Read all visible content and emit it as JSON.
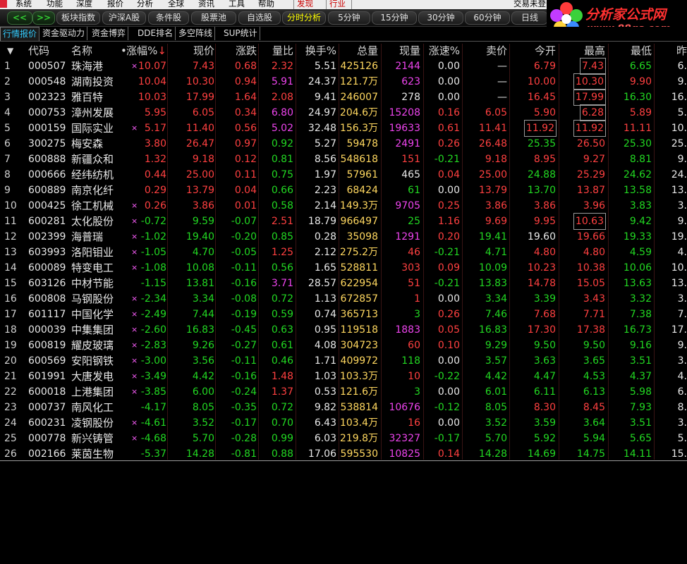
{
  "menu": {
    "items": [
      "系统",
      "功能",
      "深度",
      "报价",
      "分析",
      "全球",
      "资讯",
      "工具",
      "帮助"
    ],
    "discover": "发现",
    "industry": "行业",
    "right_text": "交易未登录"
  },
  "toolbar": {
    "buttons": [
      "板块指数",
      "沪深A股",
      "条件股",
      "股票池",
      "自选股",
      "分时分析",
      "5分钟",
      "15分钟",
      "30分钟",
      "60分钟",
      "日线"
    ]
  },
  "logo": {
    "text1": "分析家公式网",
    "text2": "www.88gs.com"
  },
  "tabs": [
    "行情报价",
    "资金驱动力",
    "资金博弈",
    "DDE排名",
    "多空阵线",
    "SUP统计"
  ],
  "columns": {
    "code": "代码",
    "name": "名称",
    "dot": "•",
    "pct": "涨幅%",
    "sort": "↓",
    "price": "现价",
    "chg": "涨跌",
    "ratio": "量比",
    "turn": "换手%",
    "vol": "总量",
    "cur": "现量",
    "spd": "涨速%",
    "sell": "卖价",
    "open": "今开",
    "high": "最高",
    "low": "最低",
    "prev": "昨"
  },
  "colors": {
    "up": "#ff4040",
    "down": "#22d822",
    "flat": "#e8e8e8",
    "volume": "#ffd860",
    "special": "#ee44ee"
  },
  "rows": [
    {
      "i": "1",
      "code": "000507",
      "name": "珠海港",
      "mk": "×",
      "pct": "10.07",
      "price": "7.43",
      "chg": "0.68",
      "ratio": "2.32",
      "turn": "5.51",
      "vol": "425126",
      "cur": "2144",
      "spd": "0.00",
      "sell": "—",
      "open": "6.79",
      "high": "7.43",
      "low": "6.65",
      "prev": "6.",
      "c": {
        "pct": "red",
        "price": "red",
        "chg": "red",
        "ratio": "red",
        "cur": "mag",
        "spd": "white",
        "sell": "white",
        "open": "red",
        "high": "red",
        "low": "green",
        "prev": "white"
      },
      "boxHigh": true
    },
    {
      "i": "2",
      "code": "000548",
      "name": "湖南投资",
      "mk": "",
      "pct": "10.04",
      "price": "10.30",
      "chg": "0.94",
      "ratio": "5.91",
      "turn": "24.37",
      "vol": "121.7万",
      "cur": "623",
      "spd": "0.00",
      "sell": "—",
      "open": "10.00",
      "high": "10.30",
      "low": "9.90",
      "prev": "9.",
      "c": {
        "pct": "red",
        "price": "red",
        "chg": "red",
        "ratio": "mag",
        "cur": "mag",
        "spd": "white",
        "sell": "white",
        "open": "red",
        "high": "red",
        "low": "red",
        "prev": "white"
      },
      "boxHigh": true
    },
    {
      "i": "3",
      "code": "002323",
      "name": "雅百特",
      "mk": "",
      "pct": "10.03",
      "price": "17.99",
      "chg": "1.64",
      "ratio": "2.08",
      "turn": "9.41",
      "vol": "246007",
      "cur": "278",
      "spd": "0.00",
      "sell": "—",
      "open": "16.45",
      "high": "17.99",
      "low": "16.30",
      "prev": "16.",
      "c": {
        "pct": "red",
        "price": "red",
        "chg": "red",
        "ratio": "red",
        "cur": "white",
        "spd": "white",
        "sell": "white",
        "open": "red",
        "high": "red",
        "low": "green",
        "prev": "white"
      },
      "boxHigh": true
    },
    {
      "i": "4",
      "code": "000753",
      "name": "漳州发展",
      "mk": "",
      "pct": "5.95",
      "price": "6.05",
      "chg": "0.34",
      "ratio": "6.80",
      "turn": "24.97",
      "vol": "204.6万",
      "cur": "15208",
      "spd": "0.16",
      "sell": "6.05",
      "open": "5.90",
      "high": "6.28",
      "low": "5.89",
      "prev": "5.",
      "c": {
        "pct": "red",
        "price": "red",
        "chg": "red",
        "ratio": "mag",
        "cur": "mag",
        "spd": "red",
        "sell": "red",
        "open": "red",
        "high": "red",
        "low": "red",
        "prev": "white"
      },
      "boxHigh": true
    },
    {
      "i": "5",
      "code": "000159",
      "name": "国际实业",
      "mk": "×",
      "pct": "5.17",
      "price": "11.40",
      "chg": "0.56",
      "ratio": "5.02",
      "turn": "32.48",
      "vol": "156.3万",
      "cur": "19633",
      "spd": "0.61",
      "sell": "11.41",
      "open": "11.92",
      "high": "11.92",
      "low": "11.11",
      "prev": "10.",
      "c": {
        "pct": "red",
        "price": "red",
        "chg": "red",
        "ratio": "mag",
        "cur": "mag",
        "spd": "red",
        "sell": "red",
        "open": "red",
        "high": "red",
        "low": "red",
        "prev": "white"
      },
      "boxHigh": true,
      "boxOpen": true
    },
    {
      "i": "6",
      "code": "300275",
      "name": "梅安森",
      "mk": "",
      "pct": "3.80",
      "price": "26.47",
      "chg": "0.97",
      "ratio": "0.92",
      "turn": "5.27",
      "vol": "59478",
      "cur": "2491",
      "spd": "0.26",
      "sell": "26.48",
      "open": "25.35",
      "high": "26.50",
      "low": "25.30",
      "prev": "25.",
      "c": {
        "pct": "red",
        "price": "red",
        "chg": "red",
        "ratio": "green",
        "cur": "mag",
        "spd": "red",
        "sell": "red",
        "open": "green",
        "high": "red",
        "low": "green",
        "prev": "white"
      }
    },
    {
      "i": "7",
      "code": "600888",
      "name": "新疆众和",
      "mk": "",
      "pct": "1.32",
      "price": "9.18",
      "chg": "0.12",
      "ratio": "0.81",
      "turn": "8.56",
      "vol": "548618",
      "cur": "151",
      "spd": "-0.21",
      "sell": "9.18",
      "open": "8.95",
      "high": "9.27",
      "low": "8.81",
      "prev": "9.",
      "c": {
        "pct": "red",
        "price": "red",
        "chg": "red",
        "ratio": "green",
        "cur": "red",
        "spd": "green",
        "sell": "red",
        "open": "red",
        "high": "red",
        "low": "green",
        "prev": "white"
      }
    },
    {
      "i": "8",
      "code": "000666",
      "name": "经纬纺机",
      "mk": "",
      "pct": "0.44",
      "price": "25.00",
      "chg": "0.11",
      "ratio": "0.75",
      "turn": "1.97",
      "vol": "57961",
      "cur": "465",
      "spd": "0.04",
      "sell": "25.00",
      "open": "24.88",
      "high": "25.29",
      "low": "24.62",
      "prev": "24.",
      "c": {
        "pct": "red",
        "price": "red",
        "chg": "red",
        "ratio": "green",
        "cur": "white",
        "spd": "red",
        "sell": "red",
        "open": "green",
        "high": "red",
        "low": "green",
        "prev": "white"
      }
    },
    {
      "i": "9",
      "code": "600889",
      "name": "南京化纤",
      "mk": "",
      "pct": "0.29",
      "price": "13.79",
      "chg": "0.04",
      "ratio": "0.66",
      "turn": "2.23",
      "vol": "68424",
      "cur": "61",
      "spd": "0.00",
      "sell": "13.79",
      "open": "13.70",
      "high": "13.87",
      "low": "13.58",
      "prev": "13.",
      "c": {
        "pct": "red",
        "price": "red",
        "chg": "red",
        "ratio": "green",
        "cur": "green",
        "spd": "white",
        "sell": "red",
        "open": "green",
        "high": "red",
        "low": "green",
        "prev": "white"
      }
    },
    {
      "i": "10",
      "code": "000425",
      "name": "徐工机械",
      "mk": "×",
      "pct": "0.26",
      "price": "3.86",
      "chg": "0.01",
      "ratio": "0.58",
      "turn": "2.14",
      "vol": "149.3万",
      "cur": "9705",
      "spd": "0.25",
      "sell": "3.86",
      "open": "3.86",
      "high": "3.96",
      "low": "3.83",
      "prev": "3.",
      "c": {
        "pct": "red",
        "price": "red",
        "chg": "red",
        "ratio": "green",
        "cur": "mag",
        "spd": "red",
        "sell": "red",
        "open": "red",
        "high": "red",
        "low": "green",
        "prev": "white"
      }
    },
    {
      "i": "11",
      "code": "600281",
      "name": "太化股份",
      "mk": "×",
      "pct": "-0.72",
      "price": "9.59",
      "chg": "-0.07",
      "ratio": "2.51",
      "turn": "18.79",
      "vol": "966497",
      "cur": "25",
      "spd": "1.16",
      "sell": "9.69",
      "open": "9.95",
      "high": "10.63",
      "low": "9.42",
      "prev": "9.",
      "c": {
        "pct": "green",
        "price": "green",
        "chg": "green",
        "ratio": "red",
        "cur": "green",
        "spd": "red",
        "sell": "red",
        "open": "red",
        "high": "red",
        "low": "green",
        "prev": "white"
      },
      "boxHigh": true
    },
    {
      "i": "12",
      "code": "002399",
      "name": "海普瑞",
      "mk": "×",
      "pct": "-1.02",
      "price": "19.40",
      "chg": "-0.20",
      "ratio": "0.85",
      "turn": "0.28",
      "vol": "35098",
      "cur": "1291",
      "spd": "0.20",
      "sell": "19.41",
      "open": "19.60",
      "high": "19.66",
      "low": "19.33",
      "prev": "19.",
      "c": {
        "pct": "green",
        "price": "green",
        "chg": "green",
        "ratio": "green",
        "cur": "mag",
        "spd": "red",
        "sell": "green",
        "open": "white",
        "high": "red",
        "low": "green",
        "prev": "white"
      }
    },
    {
      "i": "13",
      "code": "603993",
      "name": "洛阳钼业",
      "mk": "×",
      "pct": "-1.05",
      "price": "4.70",
      "chg": "-0.05",
      "ratio": "1.25",
      "turn": "2.12",
      "vol": "275.2万",
      "cur": "46",
      "spd": "-0.21",
      "sell": "4.71",
      "open": "4.80",
      "high": "4.80",
      "low": "4.59",
      "prev": "4.",
      "c": {
        "pct": "green",
        "price": "green",
        "chg": "green",
        "ratio": "red",
        "cur": "red",
        "spd": "green",
        "sell": "green",
        "open": "red",
        "high": "red",
        "low": "green",
        "prev": "white"
      }
    },
    {
      "i": "14",
      "code": "600089",
      "name": "特变电工",
      "mk": "×",
      "pct": "-1.08",
      "price": "10.08",
      "chg": "-0.11",
      "ratio": "0.56",
      "turn": "1.65",
      "vol": "528811",
      "cur": "303",
      "spd": "0.09",
      "sell": "10.09",
      "open": "10.23",
      "high": "10.38",
      "low": "10.06",
      "prev": "10.",
      "c": {
        "pct": "green",
        "price": "green",
        "chg": "green",
        "ratio": "green",
        "cur": "red",
        "spd": "red",
        "sell": "green",
        "open": "red",
        "high": "red",
        "low": "green",
        "prev": "white"
      }
    },
    {
      "i": "15",
      "code": "603126",
      "name": "中材节能",
      "mk": "",
      "pct": "-1.15",
      "price": "13.81",
      "chg": "-0.16",
      "ratio": "3.71",
      "turn": "28.57",
      "vol": "622954",
      "cur": "51",
      "spd": "-0.21",
      "sell": "13.83",
      "open": "14.78",
      "high": "15.05",
      "low": "13.63",
      "prev": "13.",
      "c": {
        "pct": "green",
        "price": "green",
        "chg": "green",
        "ratio": "mag",
        "cur": "red",
        "spd": "green",
        "sell": "green",
        "open": "red",
        "high": "red",
        "low": "green",
        "prev": "white"
      }
    },
    {
      "i": "16",
      "code": "600808",
      "name": "马钢股份",
      "mk": "×",
      "pct": "-2.34",
      "price": "3.34",
      "chg": "-0.08",
      "ratio": "0.72",
      "turn": "1.13",
      "vol": "672857",
      "cur": "1",
      "spd": "0.00",
      "sell": "3.34",
      "open": "3.39",
      "high": "3.43",
      "low": "3.32",
      "prev": "3.",
      "c": {
        "pct": "green",
        "price": "green",
        "chg": "green",
        "ratio": "green",
        "cur": "red",
        "spd": "white",
        "sell": "green",
        "open": "green",
        "high": "red",
        "low": "green",
        "prev": "white"
      }
    },
    {
      "i": "17",
      "code": "601117",
      "name": "中国化学",
      "mk": "×",
      "pct": "-2.49",
      "price": "7.44",
      "chg": "-0.19",
      "ratio": "0.59",
      "turn": "0.74",
      "vol": "365713",
      "cur": "3",
      "spd": "0.26",
      "sell": "7.46",
      "open": "7.68",
      "high": "7.71",
      "low": "7.38",
      "prev": "7.",
      "c": {
        "pct": "green",
        "price": "green",
        "chg": "green",
        "ratio": "green",
        "cur": "green",
        "spd": "red",
        "sell": "green",
        "open": "red",
        "high": "red",
        "low": "green",
        "prev": "white"
      }
    },
    {
      "i": "18",
      "code": "000039",
      "name": "中集集团",
      "mk": "×",
      "pct": "-2.60",
      "price": "16.83",
      "chg": "-0.45",
      "ratio": "0.63",
      "turn": "0.95",
      "vol": "119518",
      "cur": "1883",
      "spd": "0.05",
      "sell": "16.83",
      "open": "17.30",
      "high": "17.38",
      "low": "16.73",
      "prev": "17.",
      "c": {
        "pct": "green",
        "price": "green",
        "chg": "green",
        "ratio": "green",
        "cur": "mag",
        "spd": "red",
        "sell": "green",
        "open": "red",
        "high": "red",
        "low": "green",
        "prev": "white"
      }
    },
    {
      "i": "19",
      "code": "600819",
      "name": "耀皮玻璃",
      "mk": "×",
      "pct": "-2.83",
      "price": "9.26",
      "chg": "-0.27",
      "ratio": "0.61",
      "turn": "4.08",
      "vol": "304723",
      "cur": "60",
      "spd": "0.10",
      "sell": "9.29",
      "open": "9.50",
      "high": "9.50",
      "low": "9.16",
      "prev": "9.",
      "c": {
        "pct": "green",
        "price": "green",
        "chg": "green",
        "ratio": "green",
        "cur": "red",
        "spd": "red",
        "sell": "green",
        "open": "green",
        "high": "green",
        "low": "green",
        "prev": "white"
      }
    },
    {
      "i": "20",
      "code": "600569",
      "name": "安阳钢铁",
      "mk": "×",
      "pct": "-3.00",
      "price": "3.56",
      "chg": "-0.11",
      "ratio": "0.46",
      "turn": "1.71",
      "vol": "409972",
      "cur": "118",
      "spd": "0.00",
      "sell": "3.57",
      "open": "3.63",
      "high": "3.65",
      "low": "3.51",
      "prev": "3.",
      "c": {
        "pct": "green",
        "price": "green",
        "chg": "green",
        "ratio": "green",
        "cur": "green",
        "spd": "white",
        "sell": "green",
        "open": "green",
        "high": "green",
        "low": "green",
        "prev": "white"
      }
    },
    {
      "i": "21",
      "code": "601991",
      "name": "大唐发电",
      "mk": "×",
      "pct": "-3.49",
      "price": "4.42",
      "chg": "-0.16",
      "ratio": "1.48",
      "turn": "1.03",
      "vol": "103.3万",
      "cur": "10",
      "spd": "-0.22",
      "sell": "4.42",
      "open": "4.47",
      "high": "4.53",
      "low": "4.37",
      "prev": "4.",
      "c": {
        "pct": "green",
        "price": "green",
        "chg": "green",
        "ratio": "red",
        "cur": "red",
        "spd": "green",
        "sell": "green",
        "open": "green",
        "high": "green",
        "low": "green",
        "prev": "white"
      }
    },
    {
      "i": "22",
      "code": "600018",
      "name": "上港集团",
      "mk": "×",
      "pct": "-3.85",
      "price": "6.00",
      "chg": "-0.24",
      "ratio": "1.37",
      "turn": "0.53",
      "vol": "121.6万",
      "cur": "3",
      "spd": "0.00",
      "sell": "6.01",
      "open": "6.11",
      "high": "6.13",
      "low": "5.98",
      "prev": "6.",
      "c": {
        "pct": "green",
        "price": "green",
        "chg": "green",
        "ratio": "red",
        "cur": "green",
        "spd": "white",
        "sell": "green",
        "open": "green",
        "high": "green",
        "low": "green",
        "prev": "white"
      }
    },
    {
      "i": "23",
      "code": "000737",
      "name": "南风化工",
      "mk": "",
      "pct": "-4.17",
      "price": "8.05",
      "chg": "-0.35",
      "ratio": "0.72",
      "turn": "9.82",
      "vol": "538814",
      "cur": "10676",
      "spd": "-0.12",
      "sell": "8.05",
      "open": "8.30",
      "high": "8.45",
      "low": "7.93",
      "prev": "8.",
      "c": {
        "pct": "green",
        "price": "green",
        "chg": "green",
        "ratio": "green",
        "cur": "mag",
        "spd": "green",
        "sell": "green",
        "open": "red",
        "high": "red",
        "low": "green",
        "prev": "white"
      }
    },
    {
      "i": "24",
      "code": "600231",
      "name": "凌钢股份",
      "mk": "×",
      "pct": "-4.61",
      "price": "3.52",
      "chg": "-0.17",
      "ratio": "0.70",
      "turn": "6.43",
      "vol": "103.4万",
      "cur": "16",
      "spd": "0.00",
      "sell": "3.52",
      "open": "3.59",
      "high": "3.64",
      "low": "3.51",
      "prev": "3.",
      "c": {
        "pct": "green",
        "price": "green",
        "chg": "green",
        "ratio": "green",
        "cur": "red",
        "spd": "white",
        "sell": "green",
        "open": "green",
        "high": "green",
        "low": "green",
        "prev": "white"
      }
    },
    {
      "i": "25",
      "code": "000778",
      "name": "新兴铸管",
      "mk": "×",
      "pct": "-4.68",
      "price": "5.70",
      "chg": "-0.28",
      "ratio": "0.99",
      "turn": "6.03",
      "vol": "219.8万",
      "cur": "32327",
      "spd": "-0.17",
      "sell": "5.70",
      "open": "5.92",
      "high": "5.94",
      "low": "5.65",
      "prev": "5.",
      "c": {
        "pct": "green",
        "price": "green",
        "chg": "green",
        "ratio": "green",
        "cur": "mag",
        "spd": "green",
        "sell": "green",
        "open": "green",
        "high": "green",
        "low": "green",
        "prev": "white"
      }
    },
    {
      "i": "26",
      "code": "002166",
      "name": "莱茵生物",
      "mk": "",
      "pct": "-5.37",
      "price": "14.28",
      "chg": "-0.81",
      "ratio": "0.88",
      "turn": "17.06",
      "vol": "595530",
      "cur": "10825",
      "spd": "0.14",
      "sell": "14.28",
      "open": "14.69",
      "high": "14.75",
      "low": "14.11",
      "prev": "15.",
      "c": {
        "pct": "green",
        "price": "green",
        "chg": "green",
        "ratio": "green",
        "cur": "mag",
        "spd": "red",
        "sell": "green",
        "open": "green",
        "high": "green",
        "low": "green",
        "prev": "white"
      }
    }
  ]
}
